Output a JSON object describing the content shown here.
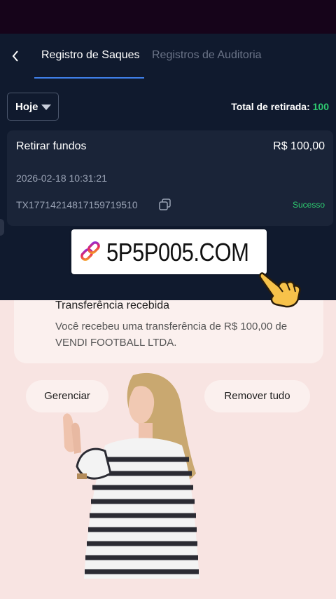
{
  "nav": {
    "back_icon": "chevron-left-icon",
    "tabs": [
      {
        "label": "Registro de Saques",
        "active": true
      },
      {
        "label": "Registros de Auditoria",
        "active": false
      }
    ]
  },
  "filter": {
    "selected": "Hoje"
  },
  "total": {
    "label": "Total de retirada:",
    "value": "100"
  },
  "record": {
    "title": "Retirar fundos",
    "amount": "R$ 100,00",
    "datetime": "2026-02-18 10:31:21",
    "tx_id": "TX17714214817159719510",
    "status": "Sucesso"
  },
  "overlay": {
    "banner_text": "5P5P005.COM"
  },
  "notification": {
    "title": "Transferência recebida",
    "body": "Você recebeu uma transferência de R$ 100,00 de VENDI FOOTBALL LTDA."
  },
  "actions": {
    "manage": "Gerenciar",
    "remove_all": "Remover tudo"
  },
  "colors": {
    "accent": "#3f7fe8",
    "success": "#2ecc71",
    "dark_bg": "#101a2e"
  }
}
